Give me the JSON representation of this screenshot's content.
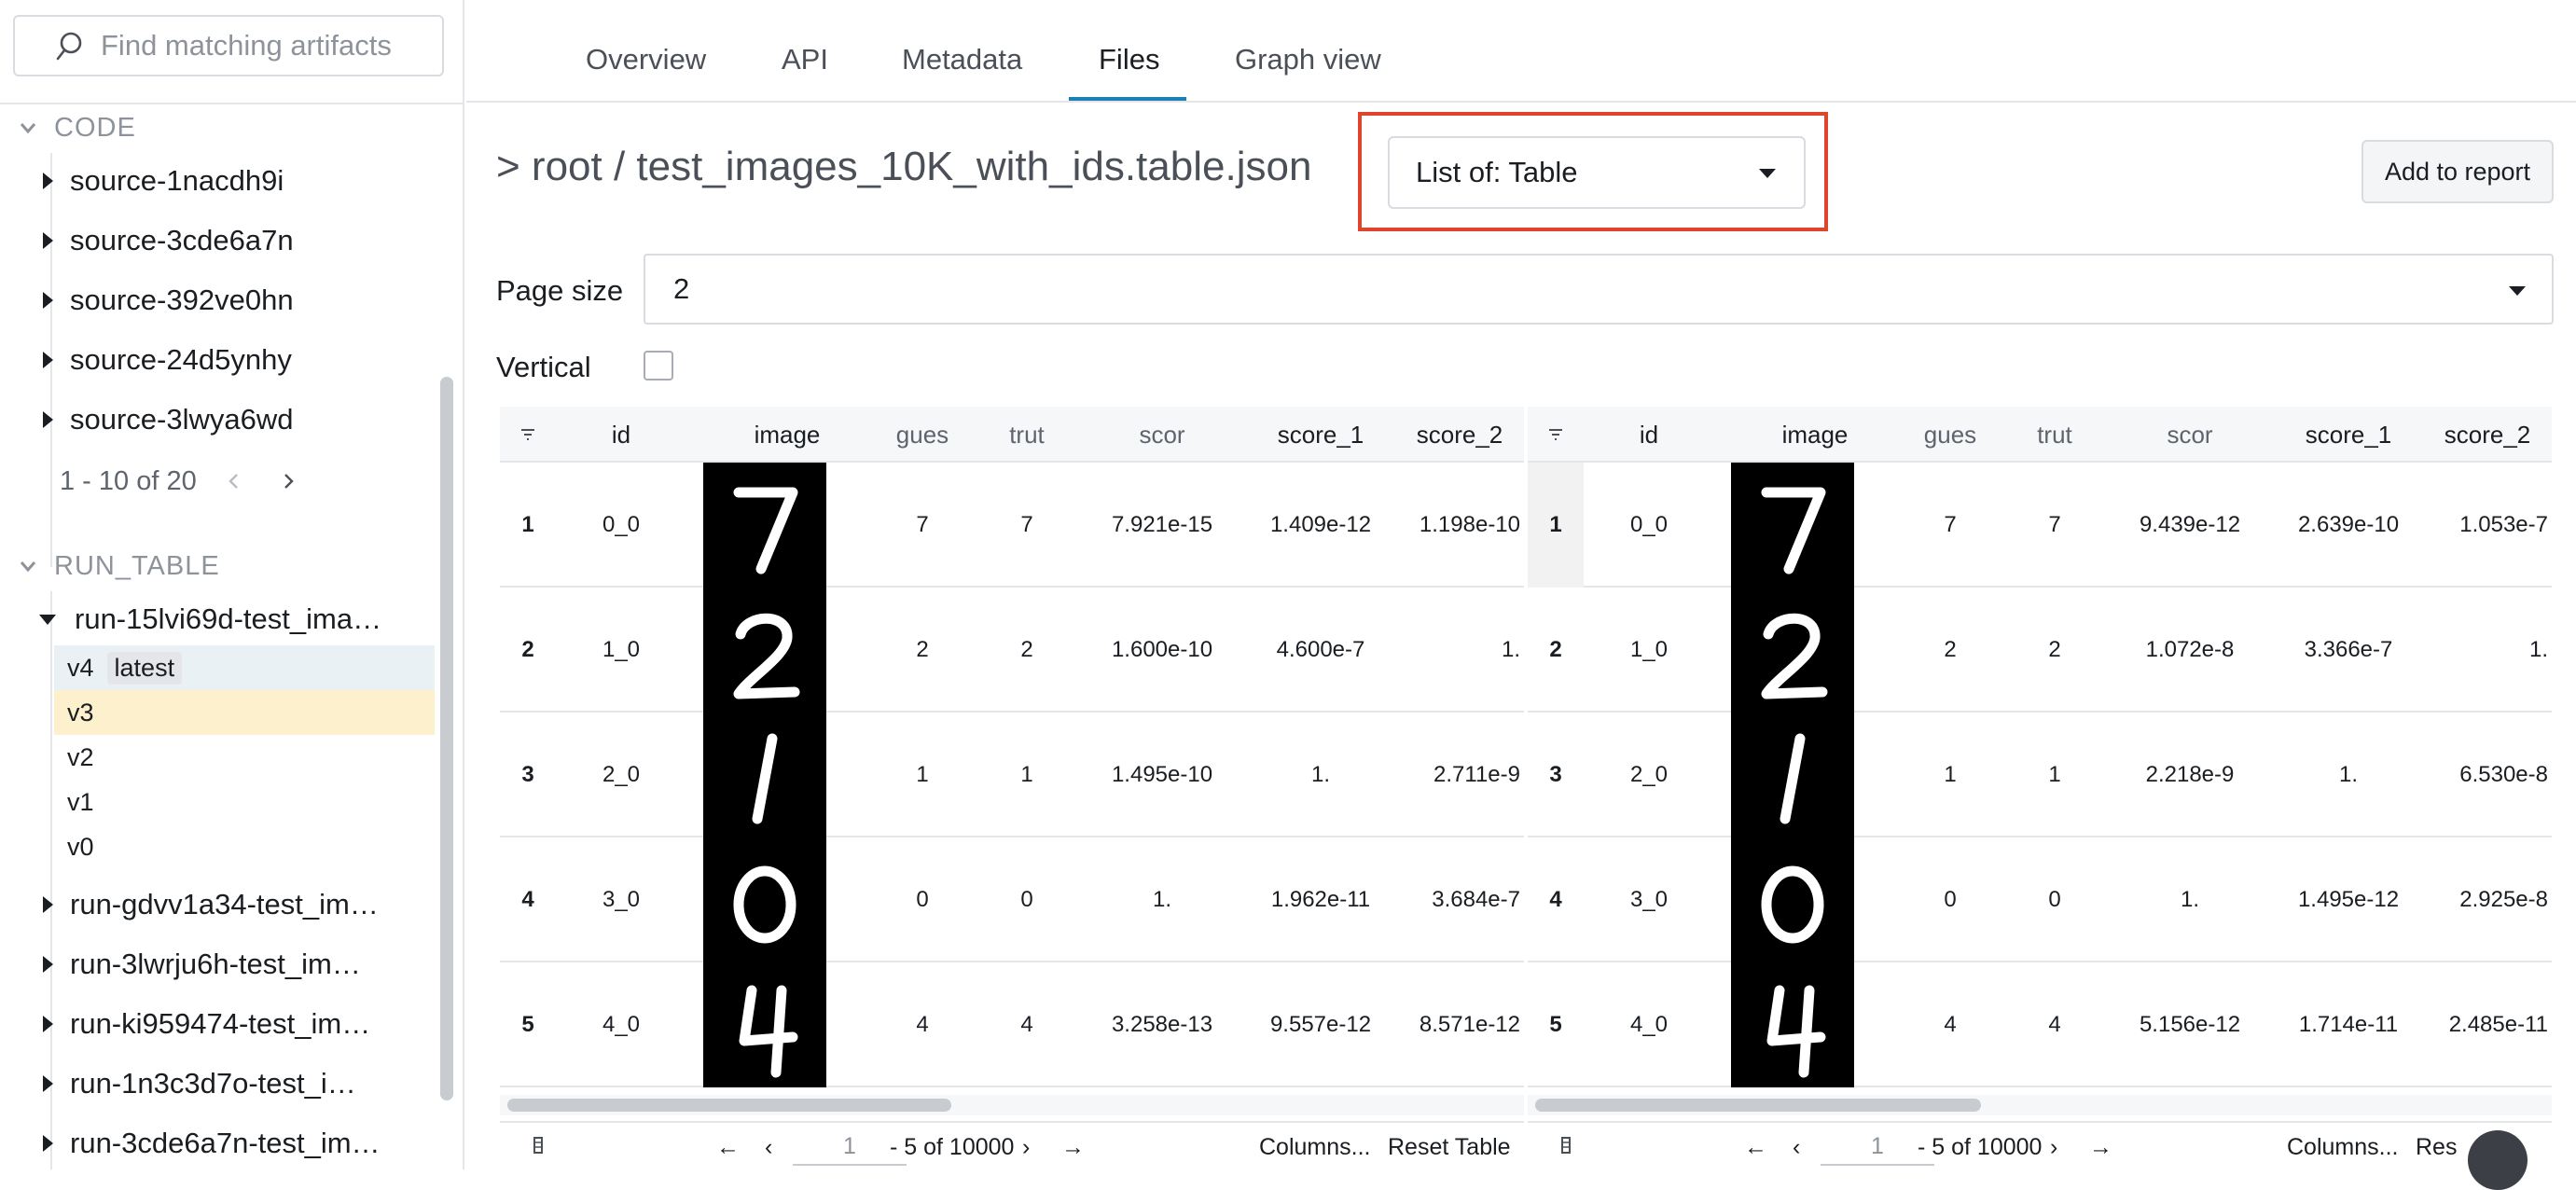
{
  "sidebar": {
    "search_placeholder": "Find matching artifacts",
    "sections": [
      {
        "title": "CODE",
        "items": [
          "source-1nacdh9i",
          "source-3cde6a7n",
          "source-392ve0hn",
          "source-24d5ynhy",
          "source-3lwya6wd"
        ],
        "pager": "1 - 10 of 20"
      },
      {
        "title": "RUN_TABLE"
      }
    ],
    "run_expanded": "run-15lvi69d-test_ima…",
    "versions": [
      {
        "label": "v4",
        "badge": "latest"
      },
      {
        "label": "v3"
      },
      {
        "label": "v2"
      },
      {
        "label": "v1"
      },
      {
        "label": "v0"
      }
    ],
    "runs": [
      "run-gdvv1a34-test_im…",
      "run-3lwrju6h-test_im…",
      "run-ki959474-test_im…",
      "run-1n3c3d7o-test_i…",
      "run-3cde6a7n-test_im…"
    ]
  },
  "tabs": [
    "Overview",
    "API",
    "Metadata",
    "Files",
    "Graph view"
  ],
  "active_tab": "Files",
  "path": "> root / test_images_10K_with_ids.table.json",
  "list_select": "List of: Table",
  "add_report": "Add to report",
  "page_size_label": "Page size",
  "page_size_value": "2",
  "vertical_label": "Vertical",
  "columns": [
    "id",
    "image",
    "gues",
    "trut",
    "scor",
    "score_1",
    "score_2"
  ],
  "tables": [
    {
      "rows": [
        {
          "n": "1",
          "id": "0_0",
          "digit": "7",
          "guess": "7",
          "truth": "7",
          "score": "7.921e-15",
          "score_1": "1.409e-12",
          "score_2": "1.198e-10"
        },
        {
          "n": "2",
          "id": "1_0",
          "digit": "2",
          "guess": "2",
          "truth": "2",
          "score": "1.600e-10",
          "score_1": "4.600e-7",
          "score_2": "1."
        },
        {
          "n": "3",
          "id": "2_0",
          "digit": "1",
          "guess": "1",
          "truth": "1",
          "score": "1.495e-10",
          "score_1": "1.",
          "score_2": "2.711e-9"
        },
        {
          "n": "4",
          "id": "3_0",
          "digit": "0",
          "guess": "0",
          "truth": "0",
          "score": "1.",
          "score_1": "1.962e-11",
          "score_2": "3.684e-7"
        },
        {
          "n": "5",
          "id": "4_0",
          "digit": "4",
          "guess": "4",
          "truth": "4",
          "score": "3.258e-13",
          "score_1": "9.557e-12",
          "score_2": "8.571e-12"
        }
      ],
      "footer": {
        "page": "1",
        "range": "- 5 of 10000",
        "columns": "Columns...",
        "reset": "Reset Table"
      }
    },
    {
      "rows": [
        {
          "n": "1",
          "id": "0_0",
          "digit": "7",
          "guess": "7",
          "truth": "7",
          "score": "9.439e-12",
          "score_1": "2.639e-10",
          "score_2": "1.053e-7"
        },
        {
          "n": "2",
          "id": "1_0",
          "digit": "2",
          "guess": "2",
          "truth": "2",
          "score": "1.072e-8",
          "score_1": "3.366e-7",
          "score_2": "1."
        },
        {
          "n": "3",
          "id": "2_0",
          "digit": "1",
          "guess": "1",
          "truth": "1",
          "score": "2.218e-9",
          "score_1": "1.",
          "score_2": "6.530e-8"
        },
        {
          "n": "4",
          "id": "3_0",
          "digit": "0",
          "guess": "0",
          "truth": "0",
          "score": "1.",
          "score_1": "1.495e-12",
          "score_2": "2.925e-8"
        },
        {
          "n": "5",
          "id": "4_0",
          "digit": "4",
          "guess": "4",
          "truth": "4",
          "score": "5.156e-12",
          "score_1": "1.714e-11",
          "score_2": "2.485e-11"
        }
      ],
      "footer": {
        "page": "1",
        "range": "- 5 of 10000",
        "columns": "Columns...",
        "reset": "Res"
      }
    }
  ],
  "colors": {
    "accent": "#1f7fb5",
    "highlight_border": "#e0442d",
    "selected_version": "#fdf0cc"
  }
}
